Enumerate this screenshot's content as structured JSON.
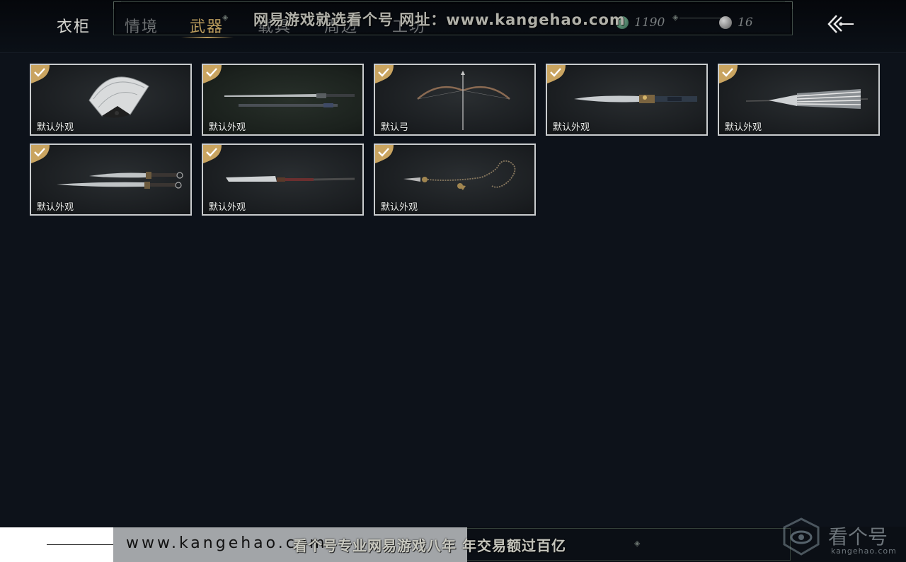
{
  "header": {
    "title": "衣柜",
    "tabs": [
      {
        "label": "情境",
        "active": false
      },
      {
        "label": "武器",
        "active": true
      },
      {
        "label": "载具",
        "active": false
      },
      {
        "label": "周边",
        "active": false
      },
      {
        "label": "工坊",
        "active": false
      }
    ],
    "currencies": [
      {
        "icon": "jade-coin-icon",
        "value": "1190"
      },
      {
        "icon": "silver-coin-icon",
        "value": "16"
      }
    ],
    "back_icon": "back-arrow-icon"
  },
  "watermark": {
    "top_text": "网易游戏就选看个号  网址：www.kangehao.com",
    "bottom_url": "www.kangehao.com",
    "bottom_text": "看个号专业网易游戏八年  年交易额过百亿",
    "brand_name": "看个号",
    "brand_domain": "kangehao.com"
  },
  "items": [
    {
      "label": "默认外观",
      "icon": "fan-icon",
      "owned": true
    },
    {
      "label": "默认外观",
      "icon": "sword-icon",
      "owned": true
    },
    {
      "label": "默认弓",
      "icon": "bow-icon",
      "owned": true
    },
    {
      "label": "默认外观",
      "icon": "blade-icon",
      "owned": true
    },
    {
      "label": "默认外观",
      "icon": "umbrella-icon",
      "owned": true
    },
    {
      "label": "默认外观",
      "icon": "dual-blades-icon",
      "owned": true
    },
    {
      "label": "默认外观",
      "icon": "glaive-icon",
      "owned": true
    },
    {
      "label": "默认外观",
      "icon": "rope-dart-icon",
      "owned": true
    }
  ],
  "colors": {
    "background": "#0d121a",
    "accent_gold": "#b99b5c",
    "card_border": "#c9ccce",
    "check_badge": "#c9a460"
  }
}
